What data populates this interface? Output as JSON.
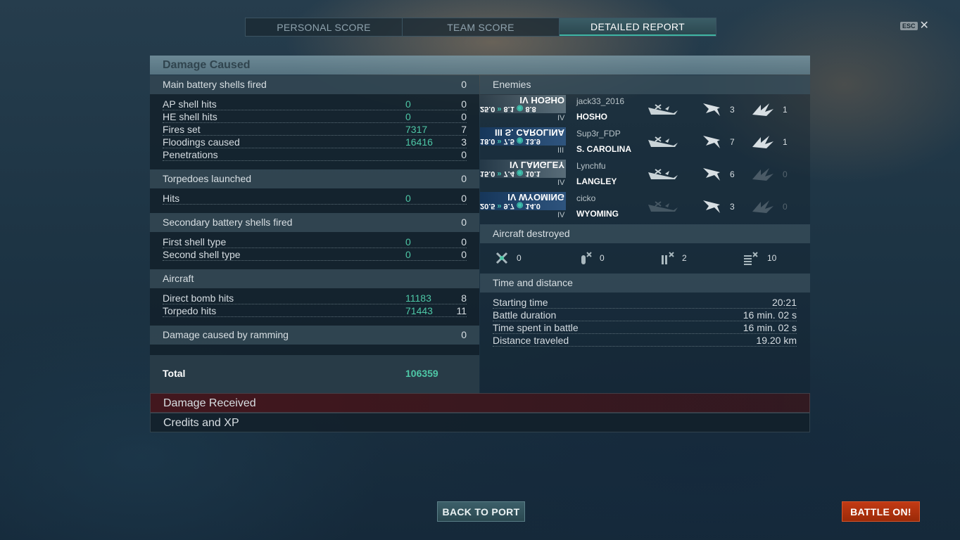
{
  "tabs": [
    {
      "label": "PERSONAL SCORE"
    },
    {
      "label": "TEAM SCORE"
    },
    {
      "label": "DETAILED REPORT"
    }
  ],
  "esc": {
    "key": "ESC",
    "close": "✕"
  },
  "damage_caused": {
    "title": "Damage Caused",
    "main_battery": {
      "label": "Main battery shells fired",
      "count": "0"
    },
    "main_rows": [
      {
        "label": "AP shell hits",
        "damage": "0",
        "count": "0"
      },
      {
        "label": "HE shell hits",
        "damage": "0",
        "count": "0"
      },
      {
        "label": "Fires set",
        "damage": "7317",
        "count": "7"
      },
      {
        "label": "Floodings caused",
        "damage": "16416",
        "count": "3"
      },
      {
        "label": "Penetrations",
        "damage": "",
        "count": "0"
      }
    ],
    "torpedoes": {
      "label": "Torpedoes launched",
      "count": "0"
    },
    "torp_rows": [
      {
        "label": "Hits",
        "damage": "0",
        "count": "0"
      }
    ],
    "secondary": {
      "label": "Secondary battery shells fired",
      "count": "0"
    },
    "sec_rows": [
      {
        "label": "First shell type",
        "damage": "0",
        "count": "0"
      },
      {
        "label": "Second shell type",
        "damage": "0",
        "count": "0"
      }
    ],
    "aircraft": {
      "label": "Aircraft"
    },
    "air_rows": [
      {
        "label": "Direct bomb hits",
        "damage": "11183",
        "count": "8"
      },
      {
        "label": "Torpedo hits",
        "damage": "71443",
        "count": "11"
      }
    ],
    "ramming": {
      "label": "Damage caused by ramming",
      "count": "0"
    },
    "total": {
      "label": "Total",
      "value": "106359"
    }
  },
  "enemies": {
    "title": "Enemies",
    "list": [
      {
        "plate_name": "IV HOSHO",
        "stats": [
          "8.8",
          "8.1",
          "25.0"
        ],
        "tier": "IV",
        "player": "jack33_2016",
        "ship": "HOSHO",
        "planes": "3",
        "torps": "1",
        "blue": false
      },
      {
        "plate_name": "III S. CAROLINA",
        "stats": [
          "13.9",
          "7.5",
          "18.0"
        ],
        "tier": "III",
        "player": "Sup3r_FDP",
        "ship": "S. CAROLINA",
        "planes": "7",
        "torps": "1",
        "blue": true
      },
      {
        "plate_name": "IV LANGLEY",
        "stats": [
          "10.1",
          "7.4",
          "15.0"
        ],
        "tier": "IV",
        "player": "Lynchfu",
        "ship": "LANGLEY",
        "planes": "6",
        "torps": "0",
        "blue": false
      },
      {
        "plate_name": "IV WYOMING",
        "stats": [
          "14.0",
          "9.7",
          "20.5"
        ],
        "tier": "IV",
        "player": "cicko",
        "ship": "WYOMING",
        "planes": "3",
        "torps": "0",
        "blue": true
      }
    ]
  },
  "aircraft_destroyed": {
    "title": "Aircraft destroyed",
    "items": [
      {
        "icon": "fighter-icon",
        "value": "0"
      },
      {
        "icon": "bomber-icon",
        "value": "0"
      },
      {
        "icon": "torpedo-bomber-icon",
        "value": "2"
      },
      {
        "icon": "squadron-icon",
        "value": "10"
      }
    ]
  },
  "time_distance": {
    "title": "Time and distance",
    "rows": [
      {
        "label": "Starting time",
        "value": "20:21"
      },
      {
        "label": "Battle duration",
        "value": "16 min. 02 s"
      },
      {
        "label": "Time spent in battle",
        "value": "16 min. 02 s"
      },
      {
        "label": "Distance traveled",
        "value": "19.20 km"
      }
    ]
  },
  "bars": {
    "received": "Damage Received",
    "credits": "Credits and XP"
  },
  "buttons": {
    "port": "BACK TO PORT",
    "battle": "BATTLE ON!"
  },
  "colors": {
    "accent": "#4ec7a6",
    "battle": "#b8320e"
  }
}
